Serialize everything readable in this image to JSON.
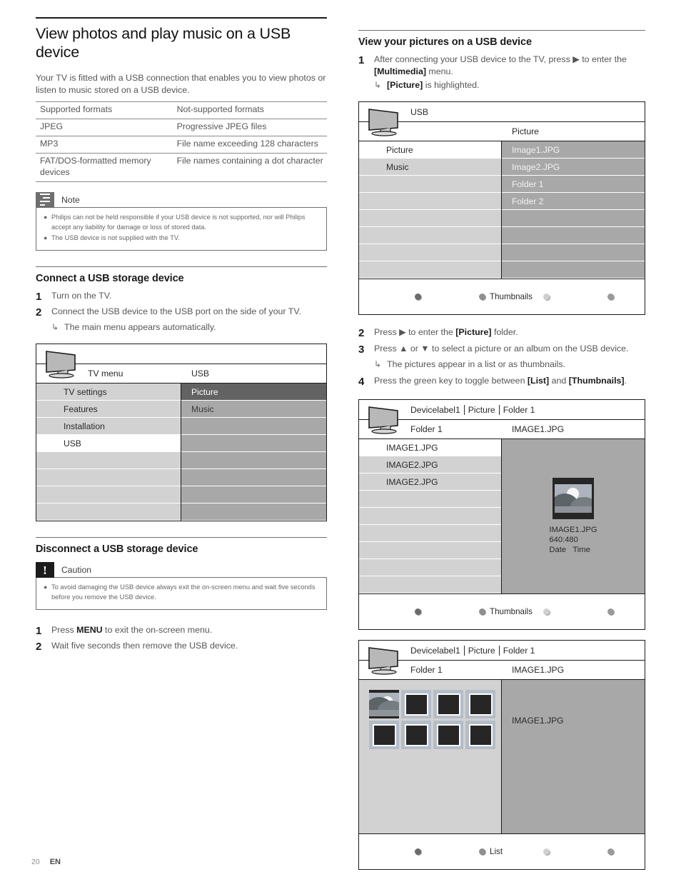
{
  "page": {
    "number": "20",
    "language": "EN"
  },
  "left": {
    "title": "View photos and play music on a USB device",
    "intro": "Your TV is fitted with a USB connection that enables you to view photos or listen to music stored on a USB device.",
    "formats_table": {
      "headers": [
        "Supported formats",
        "Not-supported formats"
      ],
      "rows": [
        [
          "JPEG",
          "Progressive JPEG files"
        ],
        [
          "MP3",
          "File name exceeding 128 characters"
        ],
        [
          "FAT/DOS-formatted memory devices",
          "File names containing a dot character"
        ]
      ],
      "row3_col1_line1": "FAT/DOS-formatted memory",
      "row3_col1_line2": "devices",
      "row3_col2": "File names containing a dot character"
    },
    "note": {
      "icon": "note-lines-icon",
      "label": "Note",
      "bullets": [
        "Philips can not be held responsible if your USB device is not supported, nor will Philips accept any liability for damage or loss of stored data.",
        "The USB device is not supplied with the TV."
      ]
    },
    "connect": {
      "heading": "Connect a USB storage device",
      "steps": [
        {
          "num": "1",
          "text": "Turn on the TV."
        },
        {
          "num": "2",
          "text": "Connect the USB device to the USB port on the side of your TV.",
          "sub": "The main menu appears automatically."
        }
      ]
    },
    "tvmenu_screen": {
      "icon": "tv-icon",
      "col_left_title": "TV menu",
      "col_right_title": "USB",
      "left_items": [
        "TV settings",
        "Features",
        "Installation",
        "USB"
      ],
      "left_selected": "USB",
      "right_items": [
        "Picture",
        "Music"
      ],
      "right_highlighted": "Picture",
      "left_blank_rows": 4,
      "right_blank_rows": 6
    },
    "disconnect": {
      "heading": "Disconnect a USB storage device",
      "caution": {
        "icon": "exclamation-icon",
        "label": "Caution",
        "bullets": [
          "To avoid damaging the USB device always exit the on-screen menu and wait five seconds before you remove the USB device."
        ]
      },
      "steps": [
        {
          "num": "1",
          "text_pre": "Press ",
          "text_bold": "MENU",
          "text_post": " to exit the on-screen menu."
        },
        {
          "num": "2",
          "text": "Wait five seconds then remove the USB device."
        }
      ]
    }
  },
  "right": {
    "heading": "View your pictures on a USB device",
    "step1": {
      "num": "1",
      "line1_pre": "After connecting your USB device to the TV, press ",
      "arrow": "▶",
      "line1_post": " to enter the ",
      "bold1": "[Multimedia]",
      "line2_post": " menu.",
      "sub_bold": "[Picture]",
      "sub_post": " is highlighted."
    },
    "screen1": {
      "icon": "tv-icon",
      "header_label": "USB",
      "col_right_title": "Picture",
      "left_items": [
        "Picture",
        "Music"
      ],
      "left_selected": "Picture",
      "right_items": [
        "Image1.JPG",
        "Image2.JPG",
        "Folder 1",
        "Folder 2"
      ],
      "left_blank_rows": 6,
      "right_blank_rows": 4,
      "buttons": [
        {
          "key": "red",
          "color": "#6b6b6b",
          "label": ""
        },
        {
          "key": "green",
          "color": "#8f8f8f",
          "label": "Thumbnails"
        },
        {
          "key": "yellow",
          "color": "#d0d0d0",
          "label": ""
        },
        {
          "key": "blue",
          "color": "#9a9a9a",
          "label": ""
        }
      ]
    },
    "steps_mid": [
      {
        "num": "2",
        "pre": "Press ",
        "arrow": "▶",
        "post": " to enter the ",
        "bold": "[Picture]",
        "tail": " folder."
      },
      {
        "num": "3",
        "pre": "Press ",
        "arrow_up": "▲",
        "mid": " or ",
        "arrow_down": "▼",
        "post": " to select a picture or an album on the USB device.",
        "sub": "The pictures appear in a list or as thumbnails."
      },
      {
        "num": "4",
        "pre": "Press the green key to toggle between ",
        "bold": "[List]",
        "mid": " and ",
        "bold2": "[Thumbnails]",
        "tail": "."
      }
    ],
    "screen2": {
      "icon": "tv-icon",
      "breadcrumbs": [
        "Devicelabel1",
        "Picture",
        "Folder 1"
      ],
      "col_left_title": "Folder 1",
      "col_right_title": "IMAGE1.JPG",
      "left_items": [
        "IMAGE1.JPG",
        "IMAGE2.JPG",
        "IMAGE2.JPG"
      ],
      "left_selected": "IMAGE1.JPG",
      "left_blank_rows": 6,
      "preview": {
        "filename": "IMAGE1.JPG",
        "resolution": "640:480",
        "date_label": "Date",
        "time_label": "Time"
      },
      "buttons": [
        {
          "key": "red",
          "color": "#6b6b6b",
          "label": ""
        },
        {
          "key": "green",
          "color": "#8f8f8f",
          "label": "Thumbnails"
        },
        {
          "key": "yellow",
          "color": "#d0d0d0",
          "label": ""
        },
        {
          "key": "blue",
          "color": "#9a9a9a",
          "label": ""
        }
      ]
    },
    "screen3": {
      "icon": "tv-icon",
      "breadcrumbs": [
        "Devicelabel1",
        "Picture",
        "Folder 1"
      ],
      "col_left_title": "Folder 1",
      "col_right_title": "IMAGE1.JPG",
      "thumbnail_count": 8,
      "selected_index": 0,
      "right_label": "IMAGE1.JPG",
      "buttons": [
        {
          "key": "red",
          "color": "#6b6b6b",
          "label": ""
        },
        {
          "key": "green",
          "color": "#8f8f8f",
          "label": "List"
        },
        {
          "key": "yellow",
          "color": "#d0d0d0",
          "label": ""
        },
        {
          "key": "blue",
          "color": "#9a9a9a",
          "label": ""
        }
      ]
    }
  }
}
